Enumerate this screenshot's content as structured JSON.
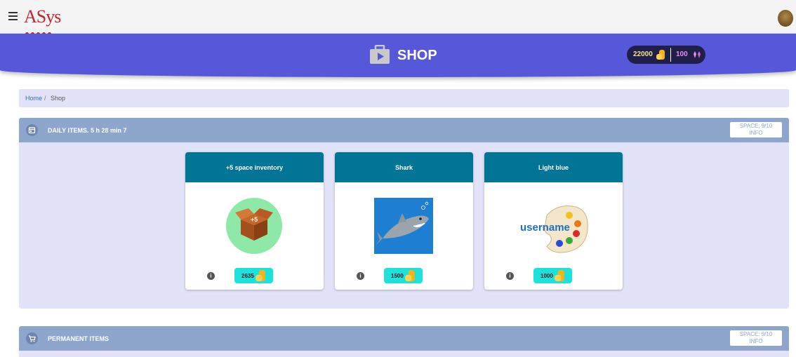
{
  "topbar": {
    "logo": "ASys",
    "menu_icon": "hamburger-menu-icon",
    "avatar_icon": "user-avatar-icon"
  },
  "header": {
    "title": "SHOP",
    "icon": "shopping-bag-icon",
    "coins": "22000",
    "gems": "100",
    "coin_icon": "coin-stack-icon",
    "gem_icon": "gem-icon",
    "color": "#5758d9"
  },
  "breadcrumb": {
    "home": "Home",
    "separator": "/",
    "current": "Shop"
  },
  "daily": {
    "title": "DAILY ITEMS. 5 h 28 min 7",
    "icon": "calendar-icon",
    "space_line1": "SPACE: 9/10",
    "space_line2": "INFO",
    "items": [
      {
        "title": "+5 space inventory",
        "price": "2635",
        "image": "box-icon",
        "badge": "+5"
      },
      {
        "title": "Shark",
        "price": "1500",
        "image": "shark-image"
      },
      {
        "title": "Light blue",
        "price": "1000",
        "image": "palette-image",
        "label": "username"
      }
    ]
  },
  "permanent": {
    "title": "PERMANENT ITEMS",
    "icon": "cart-icon",
    "space_line1": "SPACE: 9/10",
    "space_line2": "INFO"
  },
  "colors": {
    "header_bg": "#5758d9",
    "section_head_bg": "#8ea6cc",
    "card_head_bg": "#017596",
    "price_bg": "#1de2dc",
    "panel_bg": "#e2e3f8"
  }
}
